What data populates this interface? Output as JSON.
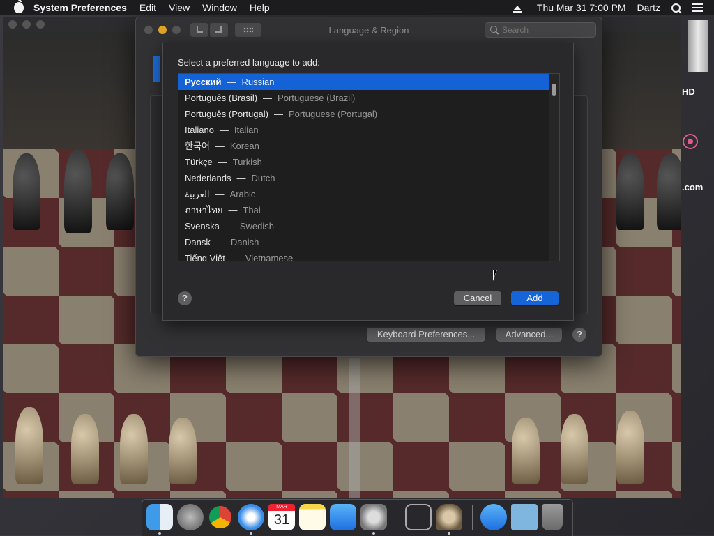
{
  "menubar": {
    "app_name": "System Preferences",
    "menus": [
      "Edit",
      "View",
      "Window",
      "Help"
    ],
    "clock": "Thu Mar 31  7:00 PM",
    "user": "Dartz"
  },
  "desktop": {
    "hd_label": "HD",
    "com_label": ".com"
  },
  "prefs_window": {
    "title": "Language & Region",
    "search_placeholder": "Search",
    "keyboard_prefs_button": "Keyboard Preferences...",
    "advanced_button": "Advanced...",
    "help": "?"
  },
  "sheet": {
    "prompt": "Select a preferred language to add:",
    "languages": [
      {
        "native": "Русский",
        "english": "Russian",
        "selected": true
      },
      {
        "native": "Português (Brasil)",
        "english": "Portuguese (Brazil)"
      },
      {
        "native": "Português (Portugal)",
        "english": "Portuguese (Portugal)"
      },
      {
        "native": "Italiano",
        "english": "Italian"
      },
      {
        "native": "한국어",
        "english": "Korean"
      },
      {
        "native": "Türkçe",
        "english": "Turkish"
      },
      {
        "native": "Nederlands",
        "english": "Dutch"
      },
      {
        "native": "العربية",
        "english": "Arabic"
      },
      {
        "native": "ภาษาไทย",
        "english": "Thai"
      },
      {
        "native": "Svenska",
        "english": "Swedish"
      },
      {
        "native": "Dansk",
        "english": "Danish"
      },
      {
        "native": "Tiếng Việt",
        "english": "Vietnamese"
      }
    ],
    "dash": "—",
    "help": "?",
    "cancel_button": "Cancel",
    "add_button": "Add"
  },
  "dock": {
    "calendar_month": "MAR",
    "calendar_day": "31",
    "apps": [
      "finder-icon",
      "launchpad-icon",
      "chrome-icon",
      "safari-icon",
      "calendar-icon",
      "notes-icon",
      "app-store-icon",
      "system-preferences-icon",
      "utility-icon",
      "chess-icon",
      "app-store-downloads-icon",
      "folder-icon",
      "trash-icon"
    ]
  },
  "colors": {
    "accent": "#1463d6",
    "board_dark": "#7a2a2a",
    "board_light": "#d9c7a8"
  }
}
